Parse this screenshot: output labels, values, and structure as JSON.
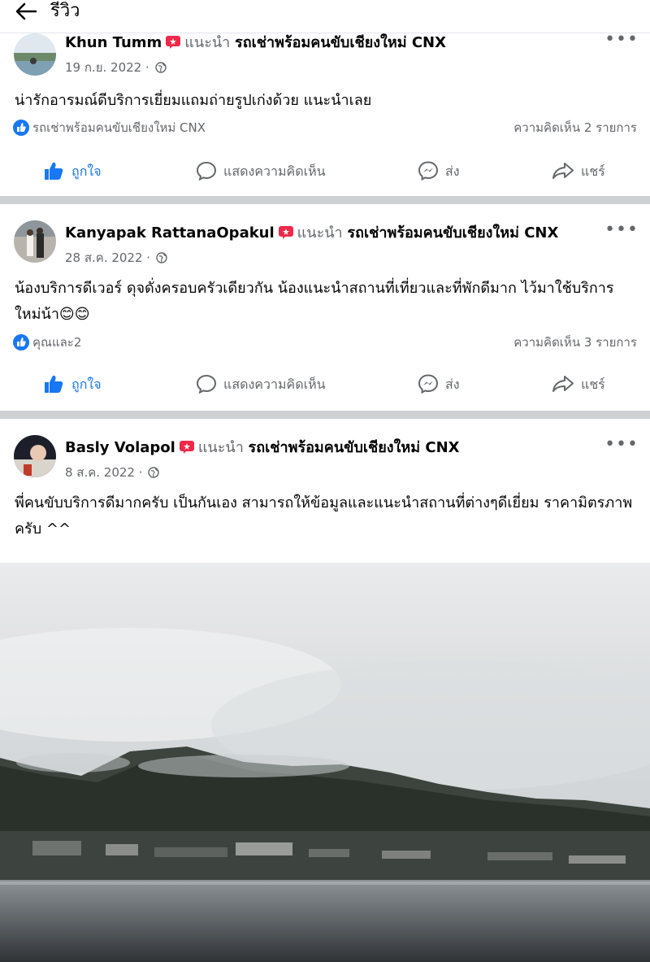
{
  "header": {
    "title": "รีวิว"
  },
  "posts": [
    {
      "author": "Khun Tumm",
      "recommends": "แนะนำ",
      "page": "รถเช่าพร้อมคนขับเชียงใหม่ CNX",
      "date": "19 ก.ย. 2022 ·",
      "text": "น่ารักอารมณ์ดีบริการเยี่ยมแถมถ่ายรูปเก่งด้วย แนะนำเลย",
      "reactions": "รถเช่าพร้อมคนขับเชียงใหม่ CNX",
      "comments": "ความคิดเห็น 2 รายการ"
    },
    {
      "author": "Kanyapak RattanaOpakul",
      "recommends": "แนะนำ",
      "page": "รถเช่าพร้อมคนขับเชียงใหม่ CNX",
      "date": "28 ส.ค. 2022 ·",
      "text": "น้องบริการดีเวอร์ ดุจดั่งครอบครัวเดียวกัน น้องแนะนำสถานที่เที่ยวและที่พักดีมาก ไว้มาใช้บริการใหม่น้า😊😊",
      "reactions": "คุณและ2",
      "comments": "ความคิดเห็น 3 รายการ"
    },
    {
      "author": "Basly Volapol",
      "recommends": "แนะนำ",
      "page": "รถเช่าพร้อมคนขับเชียงใหม่ CNX",
      "date": "8 ส.ค. 2022 ·",
      "text": "พี่คนขับบริการดีมากครับ เป็นกันเอง สามารถให้ข้อมูลและแนะนำสถานที่ต่างๆดีเยี่ยม ราคามิตรภาพครับ ^^"
    }
  ],
  "actions": {
    "like": "ถูกใจ",
    "comment": "แสดงความคิดเห็น",
    "send": "ส่ง",
    "share": "แชร์"
  },
  "colors": {
    "accent": "#1877f2",
    "recommend": "#f02849",
    "meta": "#65676b",
    "separator": "#ced0d4"
  }
}
